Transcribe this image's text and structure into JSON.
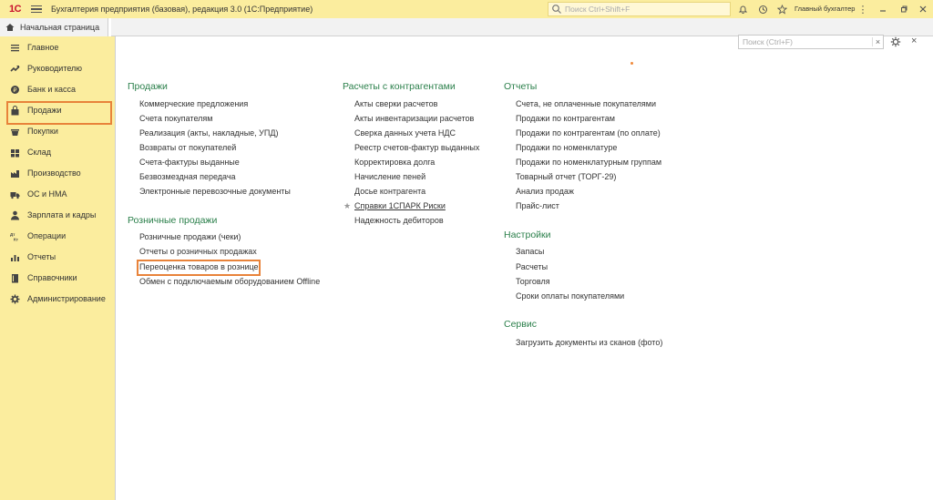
{
  "titlebar": {
    "logo": "1С",
    "title": "Бухгалтерия предприятия (базовая), редакция 3.0  (1С:Предприятие)",
    "search_placeholder": "Поиск Ctrl+Shift+F",
    "user": "Главный бухгалтер"
  },
  "tabs": {
    "home": "Начальная страница"
  },
  "sidebar": {
    "items": [
      {
        "label": "Главное",
        "icon": "menu-icon"
      },
      {
        "label": "Руководителю",
        "icon": "trend-icon"
      },
      {
        "label": "Банк и касса",
        "icon": "coin-icon"
      },
      {
        "label": "Продажи",
        "icon": "bag-icon"
      },
      {
        "label": "Покупки",
        "icon": "basket-icon"
      },
      {
        "label": "Склад",
        "icon": "warehouse-icon"
      },
      {
        "label": "Производство",
        "icon": "factory-icon"
      },
      {
        "label": "ОС и НМА",
        "icon": "truck-icon"
      },
      {
        "label": "Зарплата и кадры",
        "icon": "person-icon"
      },
      {
        "label": "Операции",
        "icon": "dt-kt-icon"
      },
      {
        "label": "Отчеты",
        "icon": "bar-chart-icon"
      },
      {
        "label": "Справочники",
        "icon": "book-icon"
      },
      {
        "label": "Администрирование",
        "icon": "gear-icon"
      }
    ]
  },
  "panel": {
    "search_placeholder": "Поиск (Ctrl+F)",
    "clear": "×",
    "close": "×"
  },
  "sections": {
    "sales": {
      "title": "Продажи",
      "links": [
        "Коммерческие предложения",
        "Счета покупателям",
        "Реализация (акты, накладные, УПД)",
        "Возвраты от покупателей",
        "Счета-фактуры выданные",
        "Безвозмездная передача",
        "Электронные перевозочные документы"
      ]
    },
    "retail": {
      "title": "Розничные продажи",
      "links": [
        "Розничные продажи (чеки)",
        "Отчеты о розничных продажах",
        "Переоценка товаров в рознице",
        "Обмен с подключаемым оборудованием Offline"
      ]
    },
    "contractors": {
      "title": "Расчеты с контрагентами",
      "links": [
        "Акты сверки расчетов",
        "Акты инвентаризации расчетов",
        "Сверка данных учета НДС",
        "Реестр счетов-фактур выданных",
        "Корректировка долга",
        "Начисление пеней",
        "Досье контрагента",
        "Справки 1СПАРК Риски",
        "Надежность дебиторов"
      ]
    },
    "reports": {
      "title": "Отчеты",
      "links": [
        "Счета, не оплаченные покупателями",
        "Продажи по контрагентам",
        "Продажи по контрагентам (по оплате)",
        "Продажи по номенклатуре",
        "Продажи по номенклатурным группам",
        "Товарный отчет (ТОРГ-29)",
        "Анализ продаж",
        "Прайс-лист"
      ]
    },
    "settings": {
      "title": "Настройки",
      "links": [
        "Запасы",
        "Расчеты",
        "Торговля",
        "Сроки оплаты покупателями"
      ]
    },
    "service": {
      "title": "Сервис",
      "links": [
        "Загрузить документы из сканов (фото)"
      ]
    }
  },
  "colors": {
    "titlebar": "#fbed9e",
    "section_title": "#2a7f4a",
    "highlight": "#e8833a"
  }
}
